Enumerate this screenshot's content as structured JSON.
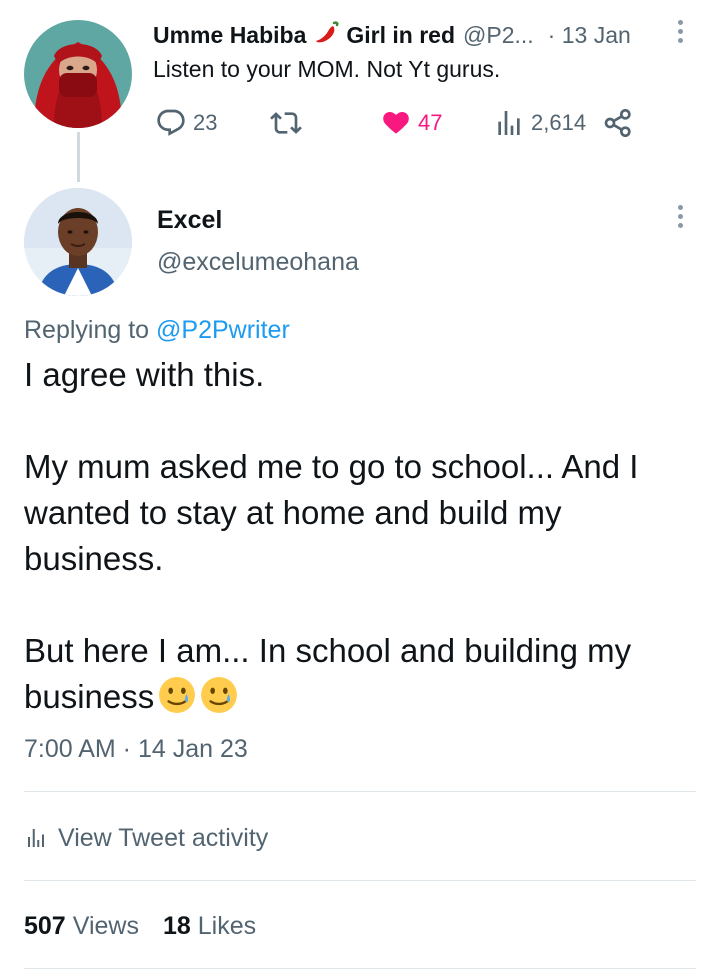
{
  "parent_tweet": {
    "display_name": "Umme Habiba",
    "display_name_2": "Girl in red",
    "handle": "@P2...",
    "date": "· 13 Jan",
    "text": "Listen to your MOM. Not Yt gurus.",
    "replies": "23",
    "likes": "47",
    "views": "2,614",
    "like_color": "#f91880"
  },
  "reply_tweet": {
    "display_name": "Excel",
    "handle": "@excelumeohana",
    "replying_prefix": "Replying to",
    "replying_to": "@P2Pwriter",
    "paragraphs": [
      "I agree with this.",
      "My mum asked me to go to school... And I wanted to stay at home and build my business.",
      "But here I am... In school and building my business"
    ],
    "timestamp": "7:00 AM · 14 Jan 23",
    "activity_label": "View Tweet activity",
    "views_count": "507",
    "views_label": "Views",
    "likes_count": "18",
    "likes_label": "Likes"
  },
  "colors": {
    "accent": "#1d9bf0",
    "muted": "#536471",
    "text": "#0f1419"
  },
  "icons": [
    "reply-icon",
    "retweet-icon",
    "heart-icon",
    "analytics-icon",
    "share-icon",
    "more-icon",
    "chili-pepper-emoji",
    "smiling-face-with-tear-emoji"
  ]
}
